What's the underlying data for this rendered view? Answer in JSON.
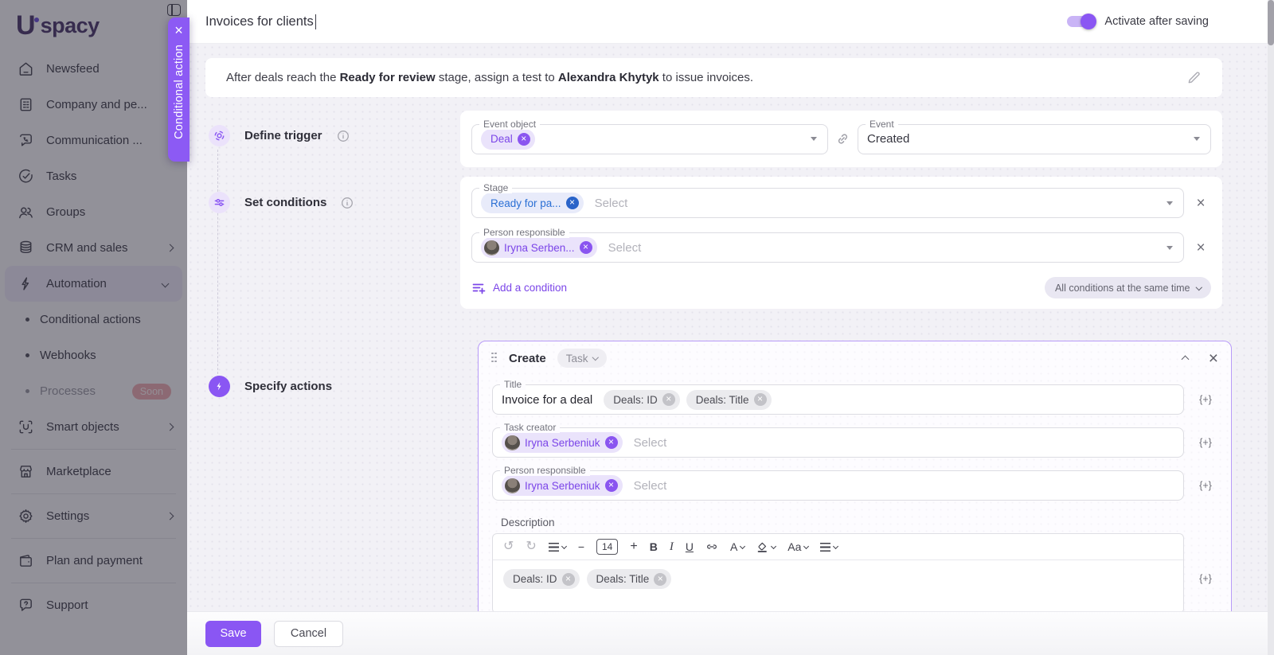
{
  "colors": {
    "accent": "#8A56F3",
    "chip_blue": "#2A6FD4",
    "sidebar_dim": "rgba(30,27,42,0.47)"
  },
  "icons": {
    "close": "×",
    "insert": "{+}"
  },
  "sidebar": {
    "logo_initial": "U",
    "logo_text": "spacy",
    "items": [
      {
        "label": "Newsfeed",
        "icon": "home"
      },
      {
        "label": "Company and pe...",
        "icon": "building",
        "chevron": "right"
      },
      {
        "label": "Communication ...",
        "icon": "chat-phone",
        "chevron": "right"
      },
      {
        "label": "Tasks",
        "icon": "check-circle"
      },
      {
        "label": "Groups",
        "icon": "users"
      },
      {
        "label": "CRM and sales",
        "icon": "database",
        "chevron": "right"
      },
      {
        "label": "Automation",
        "icon": "bolt",
        "chevron": "down",
        "active": true
      },
      {
        "label": "Conditional actions",
        "sub": true
      },
      {
        "label": "Webhooks",
        "sub": true
      },
      {
        "label": "Processes",
        "sub": true,
        "disabled": true,
        "badge": "Soon"
      },
      {
        "label": "Smart objects",
        "icon": "scan-object",
        "chevron": "right"
      },
      {
        "label": "Marketplace",
        "icon": "storefront"
      },
      {
        "label": "Settings",
        "icon": "gear",
        "chevron": "right"
      },
      {
        "label": "Plan and payment",
        "icon": "wallet"
      },
      {
        "label": "Support",
        "icon": "help-chat"
      }
    ]
  },
  "overlay_tab": {
    "label": "Conditional action"
  },
  "header": {
    "title": "Invoices for clients",
    "toggle_label": "Activate after saving",
    "toggle_on": true
  },
  "summary": {
    "part1": "After deals reach the ",
    "bold1": "Ready for review",
    "part2": " stage, assign a test to ",
    "bold2": "Alexandra Khytyk",
    "part3": " to issue invoices."
  },
  "trigger": {
    "section_label": "Define trigger",
    "event_object": {
      "label": "Event object",
      "chip": "Deal"
    },
    "event": {
      "label": "Event",
      "value": "Created"
    }
  },
  "conditions": {
    "section_label": "Set conditions",
    "rows": [
      {
        "label": "Stage",
        "chip": "Ready for pa...",
        "placeholder": "Select"
      },
      {
        "label": "Person responsible",
        "chip": "Iryna Serben...",
        "placeholder": "Select"
      }
    ],
    "add_label": "Add a condition",
    "mode_label": "All conditions at the same time"
  },
  "actions": {
    "section_label": "Specify actions",
    "create": {
      "heading": "Create",
      "type": "Task",
      "title": {
        "label": "Title",
        "value": "Invoice for a deal",
        "chips": [
          "Deals: ID",
          "Deals: Title"
        ]
      },
      "task_creator": {
        "label": "Task creator",
        "chip": "Iryna Serbeniuk",
        "placeholder": "Select"
      },
      "person_responsible": {
        "label": "Person responsible",
        "chip": "Iryna Serbeniuk",
        "placeholder": "Select"
      },
      "description": {
        "label": "Description",
        "chips": [
          "Deals: ID",
          "Deals: Title"
        ]
      }
    }
  },
  "toolbar": {
    "undo": "↺",
    "redo": "↻",
    "minus": "−",
    "font_size": "14",
    "plus": "+",
    "bold": "B",
    "italic": "I",
    "underline": "U",
    "color_letter": "A",
    "case_label": "Aa"
  },
  "footer": {
    "save": "Save",
    "cancel": "Cancel"
  }
}
